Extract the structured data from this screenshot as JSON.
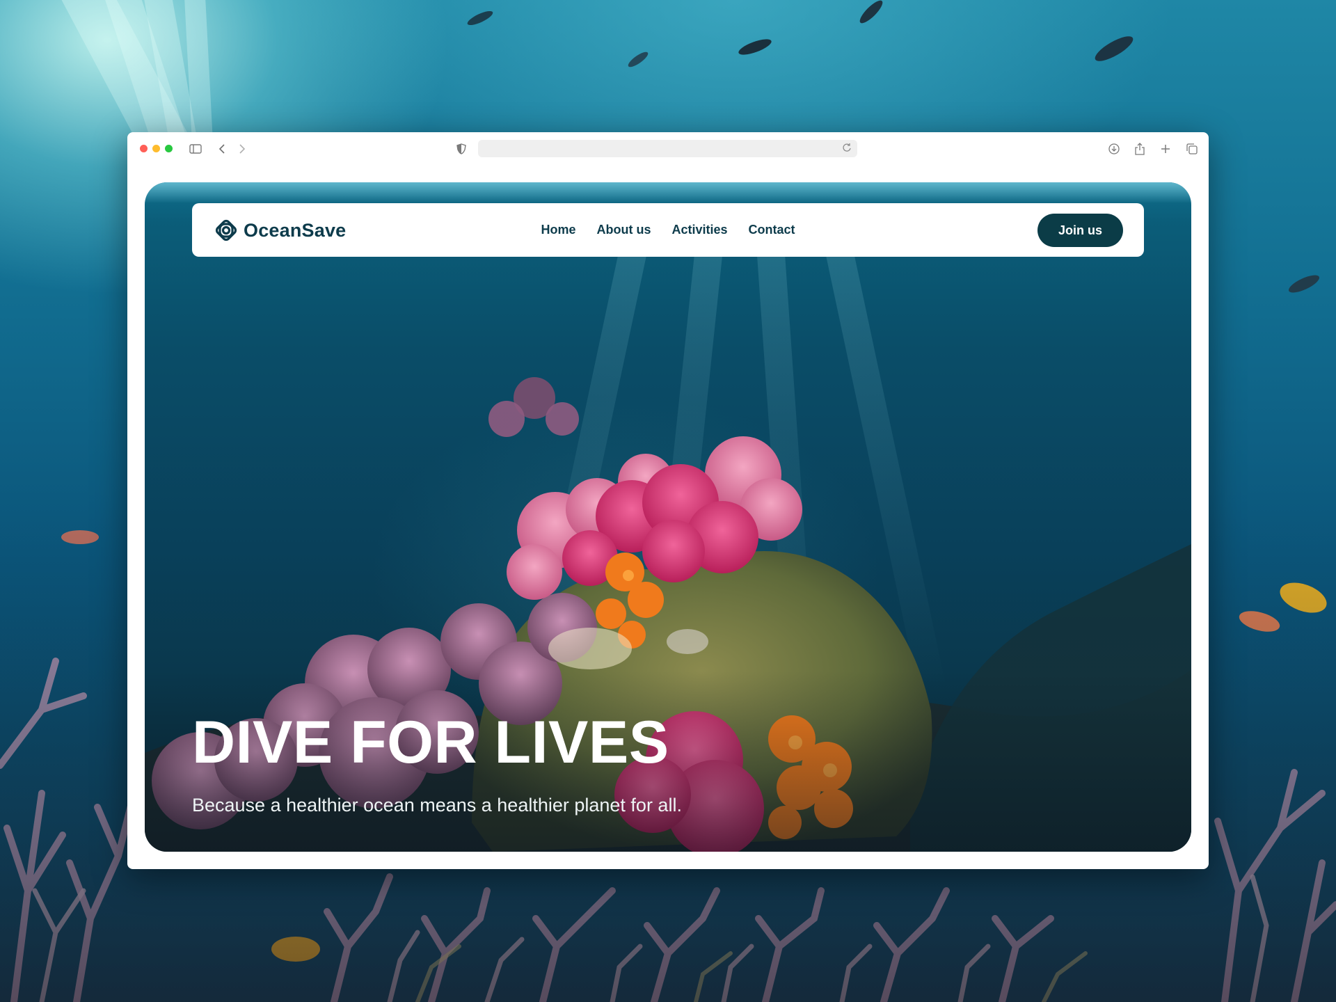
{
  "brand": {
    "name": "OceanSave",
    "logo_icon": "ocean-ring-logo-icon"
  },
  "nav": {
    "links": [
      "Home",
      "About us",
      "Activities",
      "Contact"
    ],
    "cta_label": "Join us"
  },
  "hero": {
    "headline": "DIVE FOR LIVES",
    "tagline": "Because a healthier ocean means a healthier planet for all."
  },
  "browser": {
    "traffic_lights": {
      "close": "#ff5f57",
      "minimize": "#febc2e",
      "zoom": "#28c840"
    },
    "toolbar_icons": [
      "sidebar-icon",
      "back-icon",
      "forward-icon",
      "shield-icon",
      "reload-icon",
      "download-icon",
      "share-icon",
      "new-tab-icon",
      "tabs-icon"
    ]
  },
  "colors": {
    "accent": "#0b3c47",
    "brand_text": "#0d3b4b"
  }
}
